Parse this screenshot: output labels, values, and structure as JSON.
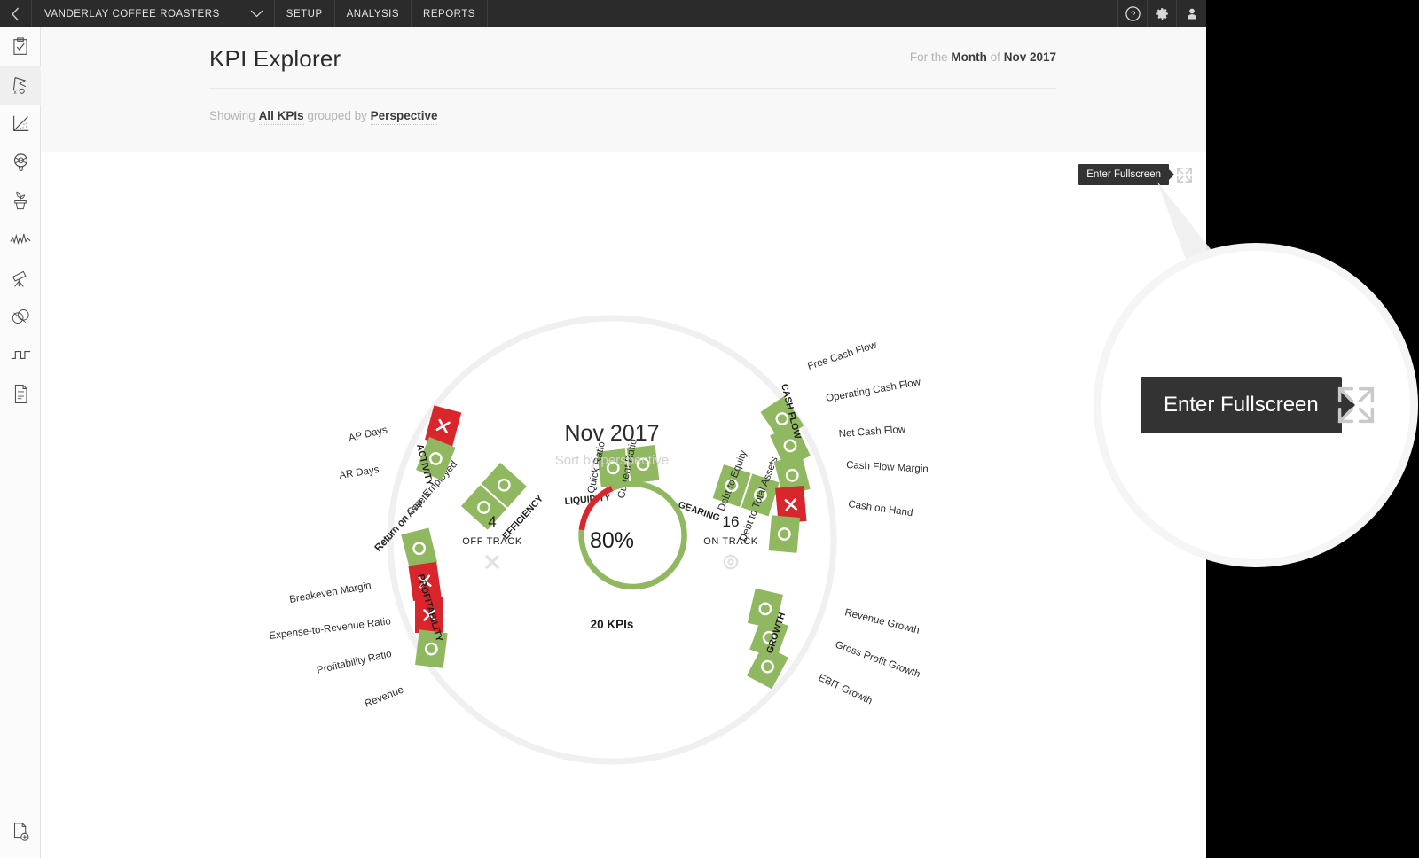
{
  "topnav": {
    "back_icon": "chevron-left-icon",
    "org_name": "VANDERLAY COFFEE ROASTERS",
    "org_caret": "chevron-down-icon",
    "items": [
      {
        "label": "SETUP"
      },
      {
        "label": "ANALYSIS"
      },
      {
        "label": "REPORTS"
      }
    ],
    "icons": [
      {
        "name": "help-icon",
        "glyph": "?"
      },
      {
        "name": "settings-gear-icon",
        "glyph": "gear"
      },
      {
        "name": "user-account-icon",
        "glyph": "person"
      }
    ]
  },
  "sidebar": {
    "items": [
      {
        "name": "clipboard-check-icon",
        "active": false
      },
      {
        "name": "scorecard-icon",
        "active": true
      },
      {
        "name": "chart-area-icon",
        "active": false
      },
      {
        "name": "target-balloon-icon",
        "active": false
      },
      {
        "name": "plant-pot-icon",
        "active": false
      },
      {
        "name": "pulse-line-icon",
        "active": false
      },
      {
        "name": "telescope-icon",
        "active": false
      },
      {
        "name": "venn-circles-icon",
        "active": false
      },
      {
        "name": "step-signal-icon",
        "active": false
      },
      {
        "name": "document-lines-icon",
        "active": false
      }
    ],
    "bottom_item": {
      "name": "document-add-icon"
    }
  },
  "header": {
    "title": "KPI Explorer",
    "period_prefix": "For the",
    "period_unit": "Month",
    "period_joiner": "of",
    "period_value": "Nov 2017",
    "showing_prefix": "Showing",
    "showing_value": "All KPIs",
    "grouped_prefix": "grouped by",
    "grouped_value": "Perspective"
  },
  "fullscreen": {
    "tooltip": "Enter Fullscreen",
    "icon": "expand-arrows-icon"
  },
  "center": {
    "period": "Nov 2017",
    "sort_hint": "Sort by perspective",
    "percent": "80%",
    "off_track_count": "4",
    "off_track_label": "OFF TRACK",
    "off_track_icon": "cross-icon",
    "on_track_count": "16",
    "on_track_label": "ON TRACK",
    "on_track_icon": "target-circle-icon",
    "total_label": "20 KPIs"
  },
  "colors": {
    "on_track": "#8fb860",
    "off_track": "#d9252c",
    "ring": "#f0f0f0",
    "nav_bg": "#2b2b2b",
    "tooltip_bg": "#333333"
  },
  "chart_data": {
    "type": "pie",
    "title": "Nov 2017",
    "subtitle": "Sort by perspective",
    "center_label": "80%",
    "total": 20,
    "total_label": "20 KPIs",
    "categories": [
      "On Track",
      "Off Track"
    ],
    "values": [
      16,
      4
    ],
    "slice_colors": [
      "#8fb860",
      "#d9252c"
    ],
    "legend_position": "sides",
    "perspectives": [
      {
        "name": "EFFICIENCY",
        "kpis": [
          {
            "label": "Return on Assets",
            "status": "on-track"
          },
          {
            "label": "Return on Cap. Employed",
            "status": "on-track"
          }
        ]
      },
      {
        "name": "LIQUIDITY",
        "kpis": [
          {
            "label": "Quick Ratio",
            "status": "on-track"
          },
          {
            "label": "Current Ratio",
            "status": "on-track"
          }
        ]
      },
      {
        "name": "GEARING",
        "kpis": [
          {
            "label": "Debt to Equity",
            "status": "on-track"
          },
          {
            "label": "Debt to Total Assets",
            "status": "on-track"
          }
        ]
      },
      {
        "name": "CASH FLOW",
        "kpis": [
          {
            "label": "Free Cash Flow",
            "status": "on-track"
          },
          {
            "label": "Operating Cash Flow",
            "status": "on-track"
          },
          {
            "label": "Net Cash Flow",
            "status": "on-track"
          },
          {
            "label": "Cash Flow Margin",
            "status": "off-track"
          },
          {
            "label": "Cash on Hand",
            "status": "on-track"
          }
        ]
      },
      {
        "name": "GROWTH",
        "kpis": [
          {
            "label": "Revenue Growth",
            "status": "on-track"
          },
          {
            "label": "Gross Profit Growth",
            "status": "on-track"
          },
          {
            "label": "EBIT Growth",
            "status": "on-track"
          }
        ]
      },
      {
        "name": "PROFITABILITY",
        "kpis": [
          {
            "label": "Breakeven Margin",
            "status": "on-track"
          },
          {
            "label": "Expense-to-Revenue Ratio",
            "status": "off-track"
          },
          {
            "label": "Profitability Ratio",
            "status": "off-track"
          },
          {
            "label": "Revenue",
            "status": "on-track"
          }
        ]
      },
      {
        "name": "ACTIVITY",
        "kpis": [
          {
            "label": "AP Days",
            "status": "off-track"
          },
          {
            "label": "AR Days",
            "status": "on-track"
          }
        ]
      }
    ]
  }
}
